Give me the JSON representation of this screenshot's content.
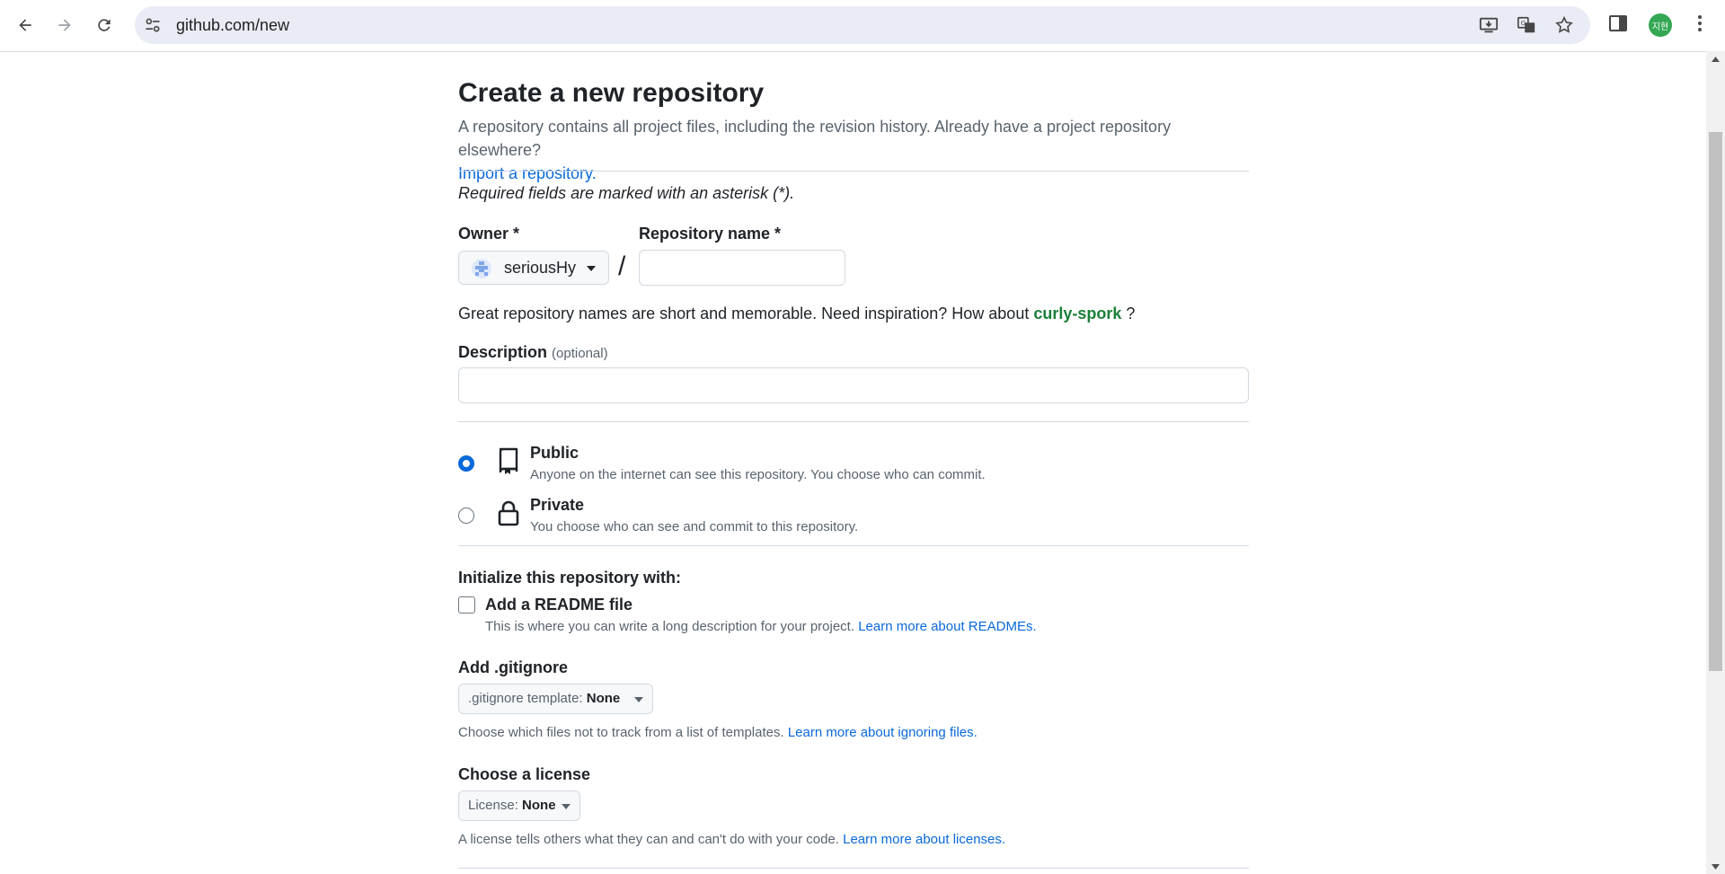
{
  "browser": {
    "url": "github.com/new",
    "profile_initials": "지현"
  },
  "page": {
    "title": "Create a new repository",
    "subtitle": "A repository contains all project files, including the revision history. Already have a project repository elsewhere?",
    "import_link": "Import a repository.",
    "required_note": "Required fields are marked with an asterisk (*).",
    "owner_label": "Owner *",
    "owner_value": "seriousHy",
    "slash": "/",
    "repo_name_label": "Repository name *",
    "repo_name_value": "",
    "hint_prefix": "Great repository names are short and memorable. Need inspiration? How about",
    "hint_suggestion": "curly-spork",
    "hint_suffix": "?",
    "description_label": "Description",
    "description_optional": "(optional)",
    "description_value": ""
  },
  "visibility": {
    "public": {
      "title": "Public",
      "description": "Anyone on the internet can see this repository. You choose who can commit.",
      "selected": true
    },
    "private": {
      "title": "Private",
      "description": "You choose who can see and commit to this repository.",
      "selected": false
    }
  },
  "initialize": {
    "heading": "Initialize this repository with:",
    "readme_label": "Add a README file",
    "readme_checked": false,
    "readme_desc": "This is where you can write a long description for your project.",
    "readme_link": "Learn more about READMEs."
  },
  "gitignore": {
    "heading": "Add .gitignore",
    "select_prefix": ".gitignore template:",
    "select_value": "None",
    "desc": "Choose which files not to track from a list of templates.",
    "link": "Learn more about ignoring files."
  },
  "license": {
    "heading": "Choose a license",
    "select_prefix": "License:",
    "select_value": "None",
    "desc": "A license tells others what they can and can't do with your code.",
    "link": "Learn more about licenses."
  },
  "colors": {
    "accent": "#0969da",
    "suggestion_green": "#1a7f37",
    "muted_text": "#59636e"
  }
}
